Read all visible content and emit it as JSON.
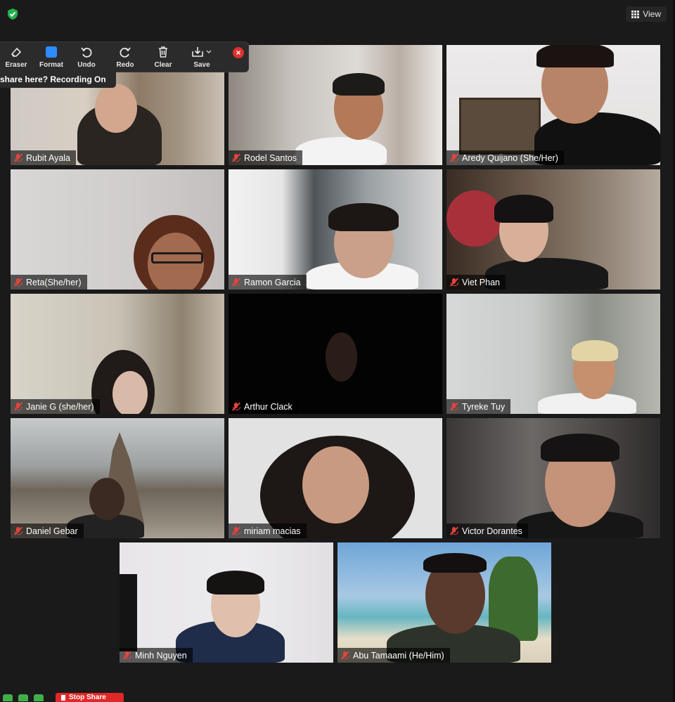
{
  "header": {
    "view_label": "View",
    "security_color": "#22b14c"
  },
  "toolbar": {
    "tools": [
      {
        "label": "Eraser",
        "icon": "eraser-icon"
      },
      {
        "label": "Format",
        "icon": "format-icon"
      },
      {
        "label": "Undo",
        "icon": "undo-icon"
      },
      {
        "label": "Redo",
        "icon": "redo-icon"
      },
      {
        "label": "Clear",
        "icon": "trash-icon"
      },
      {
        "label": "Save",
        "icon": "save-icon"
      }
    ],
    "banner": "share here? Recording On"
  },
  "participants": [
    {
      "name": "Rubit Ayala"
    },
    {
      "name": "Rodel Santos"
    },
    {
      "name": "Aredy Quijano (She/Her)"
    },
    {
      "name": "Reta(She/her)"
    },
    {
      "name": "Ramon Garcia"
    },
    {
      "name": "Viet Phan"
    },
    {
      "name": "Janie G (she/her)"
    },
    {
      "name": "Arthur Clack"
    },
    {
      "name": "Tyreke Tuy"
    },
    {
      "name": "Daniel Gebar"
    },
    {
      "name": "miriam macias"
    },
    {
      "name": "Victor Dorantes"
    },
    {
      "name": "Minh Nguyen"
    },
    {
      "name": "Abu Tamaami (He/Him)"
    }
  ],
  "footer": {
    "stop_share_label": "Stop Share"
  }
}
